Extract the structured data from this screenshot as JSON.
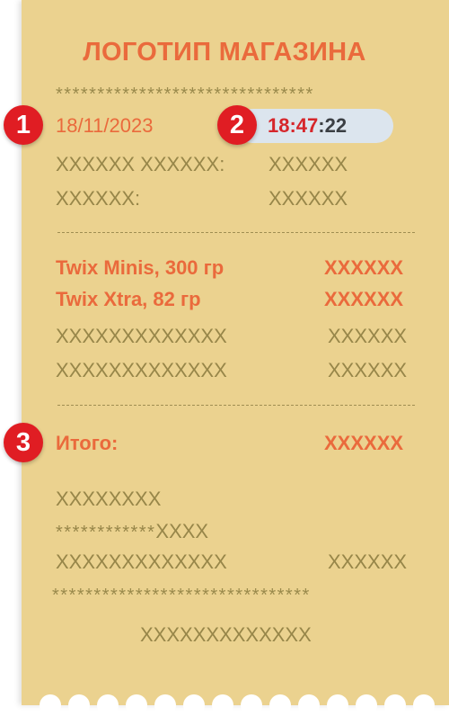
{
  "receipt": {
    "logo_text": "ЛОГОТИП МАГАЗИНА",
    "stars_top": "*******************************",
    "date": "18/11/2023",
    "time_hm": "18:47",
    "time_sep_seconds": ":22",
    "info_rows": [
      {
        "label": "XXXXXX XXXXXX:",
        "value": "XXXXXX"
      },
      {
        "label": "XXXXXX:",
        "value": "XXXXXX"
      }
    ],
    "items": [
      {
        "name": "Twix Minis, 300 гр",
        "price": "XXXXXX",
        "highlight": true
      },
      {
        "name": "Twix Xtra, 82 гр",
        "price": "XXXXXX",
        "highlight": true
      },
      {
        "name": "XXXXXXXXXXXXX",
        "price": "XXXXXX",
        "highlight": false
      },
      {
        "name": "XXXXXXXXXXXXX",
        "price": "XXXXXX",
        "highlight": false
      }
    ],
    "total_label": "Итого:",
    "total_value": "XXXXXX",
    "footer_line1": "XXXXXXXX",
    "footer_line2_stars": "************",
    "footer_line2_x": "XXXX",
    "footer_line3_label": "XXXXXXXXXXXXX",
    "footer_line3_value": "XXXXXX",
    "stars_bottom": "*******************************",
    "footer_center": "XXXXXXXXXXXXX"
  },
  "badges": [
    "1",
    "2",
    "3"
  ],
  "colors": {
    "paper": "#ebd28f",
    "accent_orange": "#ea6a3c",
    "badge_red": "#e01d23",
    "muted_text": "#978649",
    "time_pill": "#dce5ee"
  }
}
